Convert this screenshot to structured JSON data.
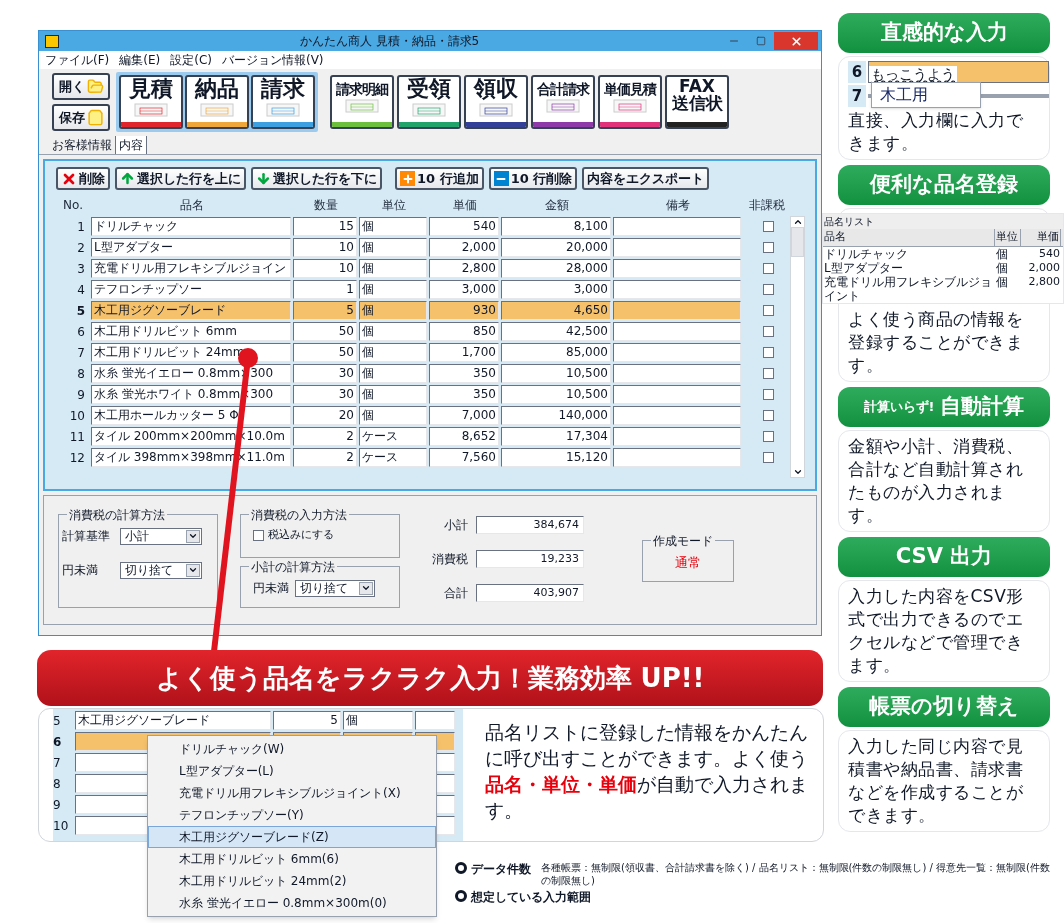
{
  "window": {
    "title": "かんたん商人 見積・納品・請求5",
    "menu": [
      "ファイル(F)",
      "編集(E)",
      "設定(C)",
      "バージョン情報(V)"
    ]
  },
  "file_buttons": [
    {
      "label": "開く",
      "kind": "open"
    },
    {
      "label": "保存",
      "kind": "save"
    }
  ],
  "form_buttons": [
    {
      "lines": [
        "見積"
      ],
      "color": "#e0262c",
      "kind": "main"
    },
    {
      "lines": [
        "納品"
      ],
      "color": "#eea63a",
      "kind": "main"
    },
    {
      "lines": [
        "請求"
      ],
      "color": "#3d9ee0",
      "kind": "main"
    },
    {
      "lines": [
        "請求明細"
      ],
      "color": "#6cbf3c",
      "kind": "extra"
    },
    {
      "lines": [
        "受領"
      ],
      "color": "#1fa36a",
      "kind": "extra"
    },
    {
      "lines": [
        "領収"
      ],
      "color": "#33409a",
      "kind": "extra"
    },
    {
      "lines": [
        "合計請求"
      ],
      "color": "#8e3aa8",
      "kind": "extra"
    },
    {
      "lines": [
        "単価見積"
      ],
      "color": "#e0317a",
      "kind": "extra"
    },
    {
      "lines": [
        "FAX",
        "送信状"
      ],
      "color": "#222222",
      "kind": "extra"
    }
  ],
  "tabs": [
    {
      "label": "お客様情報",
      "selected": false
    },
    {
      "label": "内容",
      "selected": true
    }
  ],
  "actions": [
    {
      "label": "削除",
      "kind": "delete"
    },
    {
      "label": "選択した行を上に",
      "kind": "up"
    },
    {
      "label": "選択した行を下に",
      "kind": "down"
    },
    {
      "label": "10 行追加",
      "kind": "add"
    },
    {
      "label": "10 行削除",
      "kind": "remove"
    },
    {
      "label": "内容をエクスポート",
      "kind": "none"
    }
  ],
  "table": {
    "columns": [
      "No.",
      "品名",
      "数量",
      "単位",
      "単価",
      "金額",
      "備考",
      "非課税"
    ],
    "rows": [
      {
        "no": "1",
        "name": "ドリルチャック",
        "qty": "15",
        "unit": "個",
        "price": "540",
        "amount": "8,100",
        "tax_exempt": false,
        "selected": false
      },
      {
        "no": "2",
        "name": "L型アダプター",
        "qty": "10",
        "unit": "個",
        "price": "2,000",
        "amount": "20,000",
        "tax_exempt": false,
        "selected": false
      },
      {
        "no": "3",
        "name": "充電ドリル用フレキシブルジョイン",
        "qty": "10",
        "unit": "個",
        "price": "2,800",
        "amount": "28,000",
        "tax_exempt": false,
        "selected": false
      },
      {
        "no": "4",
        "name": "テフロンチップソー",
        "qty": "1",
        "unit": "個",
        "price": "3,000",
        "amount": "3,000",
        "tax_exempt": false,
        "selected": false
      },
      {
        "no": "5",
        "name": "木工用ジグソーブレード",
        "qty": "5",
        "unit": "個",
        "price": "930",
        "amount": "4,650",
        "tax_exempt": false,
        "selected": true
      },
      {
        "no": "6",
        "name": "木工用ドリルビット 6mm",
        "qty": "50",
        "unit": "個",
        "price": "850",
        "amount": "42,500",
        "tax_exempt": false,
        "selected": false
      },
      {
        "no": "7",
        "name": "木工用ドリルビット 24mm",
        "qty": "50",
        "unit": "個",
        "price": "1,700",
        "amount": "85,000",
        "tax_exempt": false,
        "selected": false
      },
      {
        "no": "8",
        "name": "水糸 蛍光イエロー 0.8mm×300",
        "qty": "30",
        "unit": "個",
        "price": "350",
        "amount": "10,500",
        "tax_exempt": false,
        "selected": false
      },
      {
        "no": "9",
        "name": "水糸 蛍光ホワイト 0.8mm×300",
        "qty": "30",
        "unit": "個",
        "price": "350",
        "amount": "10,500",
        "tax_exempt": false,
        "selected": false
      },
      {
        "no": "10",
        "name": "木工用ホールカッター 5 Φ",
        "qty": "20",
        "unit": "個",
        "price": "7,000",
        "amount": "140,000",
        "tax_exempt": false,
        "selected": false
      },
      {
        "no": "11",
        "name": "タイル 200mm×200mm×10.0m",
        "qty": "2",
        "unit": "ケース",
        "price": "8,652",
        "amount": "17,304",
        "tax_exempt": false,
        "selected": false
      },
      {
        "no": "12",
        "name": "タイル 398mm×398mm×11.0m",
        "qty": "2",
        "unit": "ケース",
        "price": "7,560",
        "amount": "15,120",
        "tax_exempt": false,
        "selected": false
      }
    ]
  },
  "tax_calc": {
    "title": "消費税の計算方法",
    "fields": [
      {
        "label": "計算基準",
        "value": "小計"
      },
      {
        "label": "円未満",
        "value": "切り捨て"
      }
    ]
  },
  "tax_input": {
    "title": "消費税の入力方法",
    "checkbox": {
      "label": "税込みにする",
      "checked": false
    }
  },
  "subtotal_calc": {
    "title": "小計の計算方法",
    "field": {
      "label": "円未満",
      "value": "切り捨て"
    }
  },
  "totals": [
    {
      "label": "小計",
      "value": "384,674"
    },
    {
      "label": "消費税",
      "value": "19,233"
    },
    {
      "label": "合計",
      "value": "403,907"
    }
  ],
  "mode": {
    "title": "作成モード",
    "value": "通常"
  },
  "banner": "よく使う品名をラクラク入力！業務効率 UP!!",
  "demo": {
    "rows": [
      {
        "no": "5",
        "name": "木工用ジグソーブレード",
        "qty": "5",
        "unit": "個",
        "selected": false
      },
      {
        "no": "6",
        "selected": true
      },
      {
        "no": "7",
        "selected": false
      },
      {
        "no": "8",
        "selected": false
      },
      {
        "no": "9",
        "selected": false
      },
      {
        "no": "10",
        "selected": false
      }
    ],
    "menu": [
      {
        "label": "ドリルチャック(W)",
        "selected": false
      },
      {
        "label": "L型アダプター(L)",
        "selected": false
      },
      {
        "label": "充電ドリル用フレキシブルジョイント(X)",
        "selected": false
      },
      {
        "label": "テフロンチップソー(Y)",
        "selected": false
      },
      {
        "label": "木工用ジグソーブレード(Z)",
        "selected": true
      },
      {
        "label": "木工用ドリルビット 6mm(6)",
        "selected": false
      },
      {
        "label": "木工用ドリルビット 24mm(2)",
        "selected": false
      },
      {
        "label": "水糸 蛍光イエロー 0.8mm×300m(0)",
        "selected": false
      }
    ],
    "text": "品名リストに登録した情報をかんたんに呼び出すことができます。よく使う**品名・単位・単価**が自動で入力されます。"
  },
  "features": [
    {
      "title": "直感的な入力",
      "kind": "ime",
      "text": "直接、入力欄に入力できます。",
      "ime": {
        "rows": [
          {
            "no": "6",
            "value": "もっこうよう"
          },
          {
            "no": "7"
          }
        ],
        "suggestion": "木工用"
      }
    },
    {
      "title": "便利な品名登録",
      "kind": "list",
      "text": "よく使う商品の情報を登録することができます。",
      "list": {
        "title": "品名リスト",
        "columns": [
          "品名",
          "単位",
          "単価"
        ],
        "rows": [
          [
            "ドリルチャック",
            "個",
            "540"
          ],
          [
            "L型アダプター",
            "個",
            "2,000"
          ],
          [
            "充電ドリル用フレキシブルジョイント",
            "個",
            "2,800"
          ]
        ]
      }
    },
    {
      "title": "自動計算",
      "prefix": "計算いらず!",
      "kind": "plain",
      "text": "金額や小計、消費税、合計など自動計算されたものが入力されます。"
    },
    {
      "title": "CSV 出力",
      "kind": "plain",
      "text": "入力した内容をCSV形式で出力できるのでエクセルなどで管理できます。"
    },
    {
      "title": "帳票の切り替え",
      "kind": "plain",
      "text": "入力した同じ内容で見積書や納品書、請求書などを作成することができます。"
    }
  ],
  "notes": [
    {
      "title": "データ件数",
      "detail": "各種帳票：無制限(領収書、合計請求書を除く) / 品名リスト：無制限(件数の制限無し) / 得意先一覧：無制限(件数の制限無し)"
    },
    {
      "title": "想定している入力範囲"
    }
  ]
}
